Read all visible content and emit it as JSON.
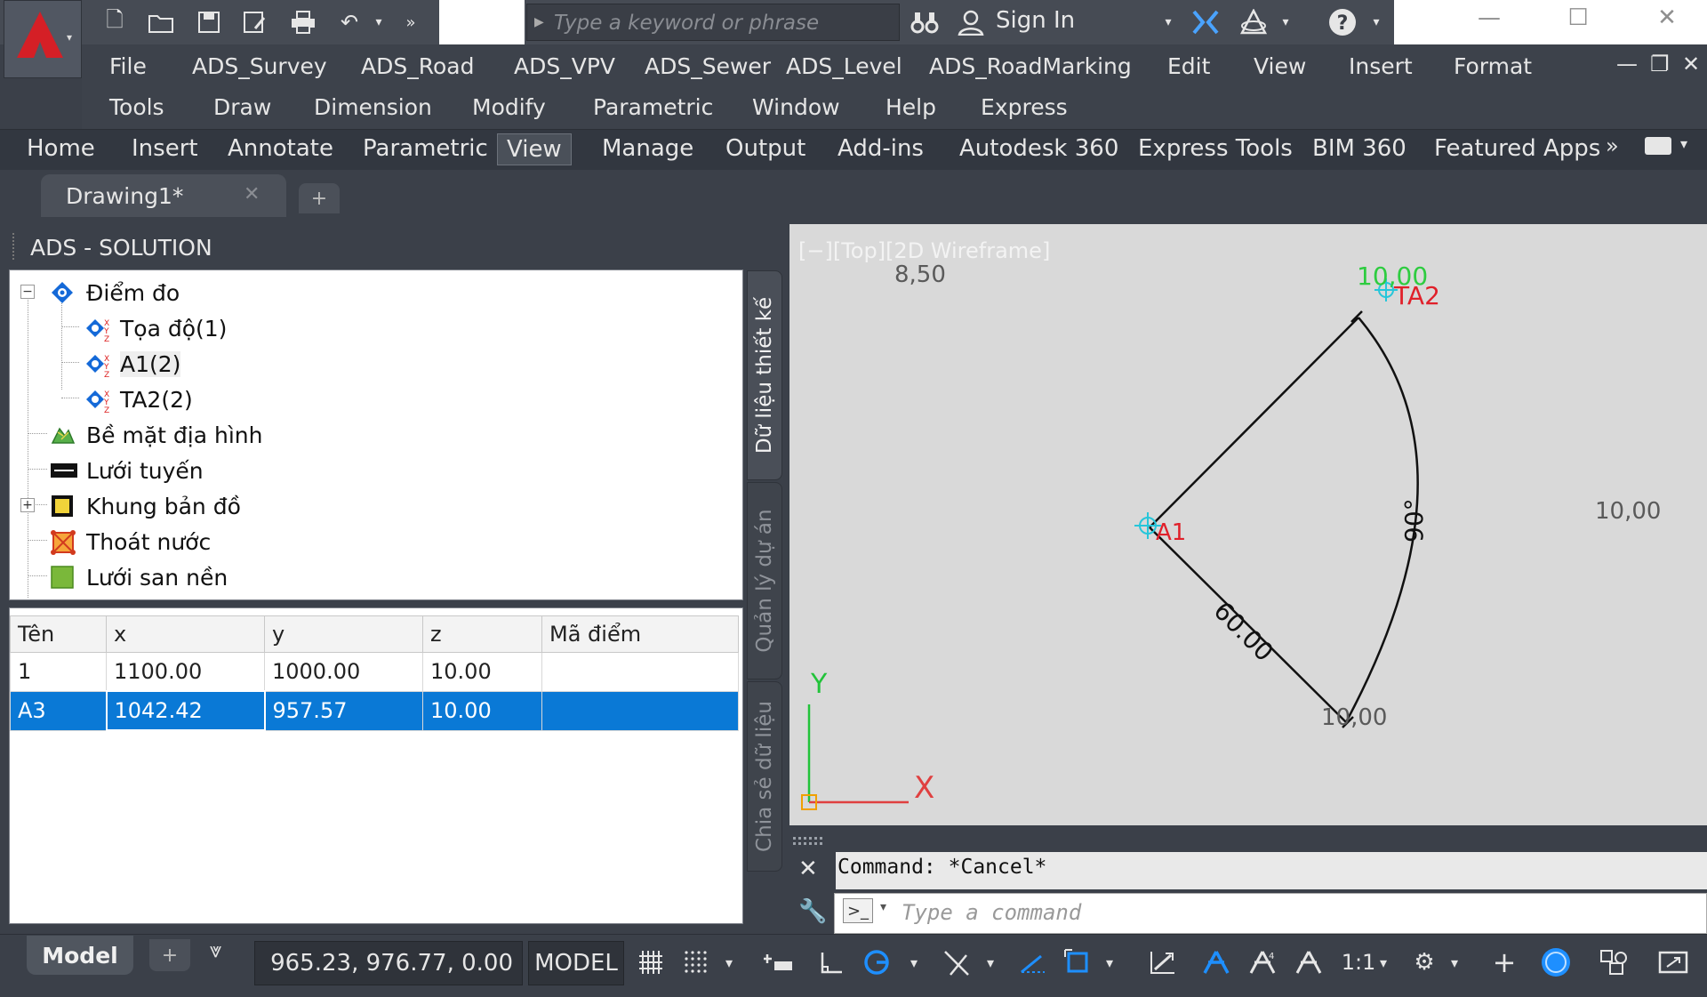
{
  "quick_access": {
    "search_placeholder": "Type a keyword or phrase",
    "sign_in": "Sign In"
  },
  "menubar": {
    "row1": [
      "File",
      "ADS_Survey",
      "ADS_Road",
      "ADS_VPV",
      "ADS_Sewer",
      "ADS_Level",
      "ADS_RoadMarking",
      "Edit",
      "View",
      "Insert",
      "Format"
    ],
    "row2": [
      "Tools",
      "Draw",
      "Dimension",
      "Modify",
      "Parametric",
      "Window",
      "Help",
      "Express"
    ]
  },
  "ribbon_tabs": [
    "Home",
    "Insert",
    "Annotate",
    "Parametric",
    "View",
    "Manage",
    "Output",
    "Add-ins",
    "Autodesk 360",
    "Express Tools",
    "BIM 360",
    "Featured Apps"
  ],
  "active_ribbon_tab": "View",
  "document_tab": {
    "label": "Drawing1*"
  },
  "palette": {
    "title": "ADS - SOLUTION",
    "tree": [
      {
        "label": "Điểm đo",
        "icon": "survey-point-icon"
      },
      {
        "label": "Tọa độ(1)",
        "icon": "coordinate-point-icon"
      },
      {
        "label": "A1(2)",
        "icon": "coordinate-point-icon"
      },
      {
        "label": "TA2(2)",
        "icon": "coordinate-point-icon"
      },
      {
        "label": "Bề mặt địa hình",
        "icon": "terrain-surface-icon"
      },
      {
        "label": "Lưới tuyến",
        "icon": "route-grid-icon"
      },
      {
        "label": "Khung bản đồ",
        "icon": "map-frame-icon"
      },
      {
        "label": "Thoát nước",
        "icon": "drainage-icon"
      },
      {
        "label": "Lưới san nền",
        "icon": "grading-grid-icon"
      }
    ],
    "grid": {
      "columns": [
        "Tên",
        "x",
        "y",
        "z",
        "Mã điểm"
      ],
      "rows": [
        [
          "1",
          "1100.00",
          "1000.00",
          "10.00",
          ""
        ],
        [
          "A3",
          "1042.42",
          "957.57",
          "10.00",
          ""
        ]
      ]
    },
    "side_tabs": [
      "Dữ liệu thiết kế",
      "Quản lý dự án",
      "Chia sẻ dữ liệu"
    ]
  },
  "viewport": {
    "label": "[−][Top][2D Wireframe]",
    "labels": {
      "top_left_value": "8,50",
      "top_point_value": "10,00",
      "top_point_name": "TA2",
      "center_point_name": "A1",
      "right_value": "10,00",
      "radius_label": "60.00",
      "angle_label": "90°",
      "bottom_value": "10,00"
    },
    "ucs": {
      "y": "Y",
      "x": "X"
    },
    "colors": {
      "background": "#d9d9d9",
      "point_green": "#2ecc40",
      "point_red": "#e0202a",
      "ucs_green": "#22c33a",
      "ucs_red": "#e04040"
    }
  },
  "command": {
    "history": "Command: *Cancel*",
    "placeholder": "Type a command"
  },
  "statusbar": {
    "model_tab": "Model",
    "coordinates": "965.23, 976.77, 0.00",
    "space": "MODEL",
    "scale": "1:1"
  }
}
